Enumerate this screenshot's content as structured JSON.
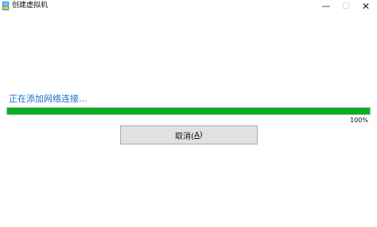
{
  "window": {
    "title": "创建虚拟机",
    "minimize_glyph": "—",
    "maximize_glyph": "☐",
    "close_glyph": "✕"
  },
  "status": {
    "message": "正在添加网络连接...",
    "progress": 1.0,
    "percent_label": "100%"
  },
  "actions": {
    "cancel_label": "取消(",
    "cancel_accel": "A",
    "cancel_suffix": ")"
  },
  "colors": {
    "progress_fill": "#06b025",
    "status_text": "#1c6fc8"
  }
}
